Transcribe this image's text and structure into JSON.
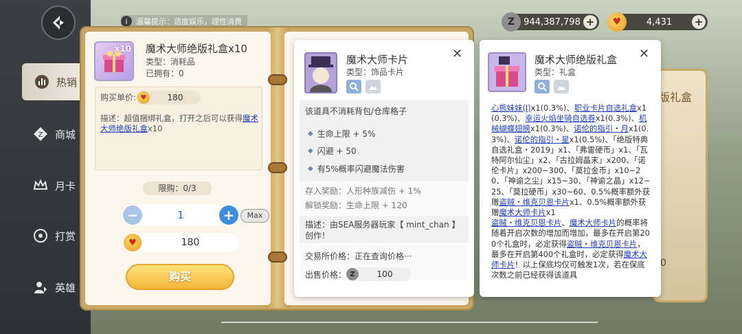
{
  "topbar": {
    "tip": "温馨提示：适度娱乐，理性消费",
    "currency1": "944,387,798",
    "currency2": "4,431",
    "plus": "+"
  },
  "sidebar": {
    "items": [
      {
        "label": "热销",
        "icon": "chart-icon"
      },
      {
        "label": "商城",
        "icon": "z-coin-icon"
      },
      {
        "label": "月卡",
        "icon": "crown-icon"
      },
      {
        "label": "打赏",
        "icon": "reward-icon"
      },
      {
        "label": "英雄",
        "icon": "hero-icon"
      }
    ]
  },
  "item": {
    "name": "魔术大师绝版礼盒x10",
    "type": "类型：消耗品",
    "owned": "已拥有：0",
    "badge": "x10",
    "unit_price_label": "购买单价:",
    "unit_price": "180",
    "desc_prefix": "描述：超值捆绑礼盒，打开之后可以获得",
    "desc_link": "魔术大师绝版礼盒",
    "desc_suffix": "x10",
    "limit": "限购：0/3",
    "quantity": "1",
    "max_label": "Max",
    "total": "180",
    "buy_label": "购买"
  },
  "card_popup": {
    "title": "魔术大师卡片",
    "type": "类型：饰品卡片",
    "note": "该道具不消耗背包/仓库格子",
    "stats": [
      "生命上限 + 5%",
      "闪避 + 50",
      "有5%概率闪避魔法伤害"
    ],
    "store_reward": "存入奖励：人形种族减伤 + 1%",
    "unlock_reward": "解锁奖励：生命上限 + 120",
    "desc": "描述：由SEA服务器玩家【 mint_chan 】创作！",
    "market_price": "交易所价格：正在查询价格···",
    "sell_price_label": "出售价格：",
    "sell_price": "100"
  },
  "box_popup": {
    "title": "魔术大师绝版礼盒",
    "type": "类型：礼盒",
    "bg_label": "版礼盒",
    "bg_num": "0"
  },
  "colors": {
    "accent": "#f2b73a",
    "link": "#1f3fbf",
    "book": "#c8a562"
  }
}
